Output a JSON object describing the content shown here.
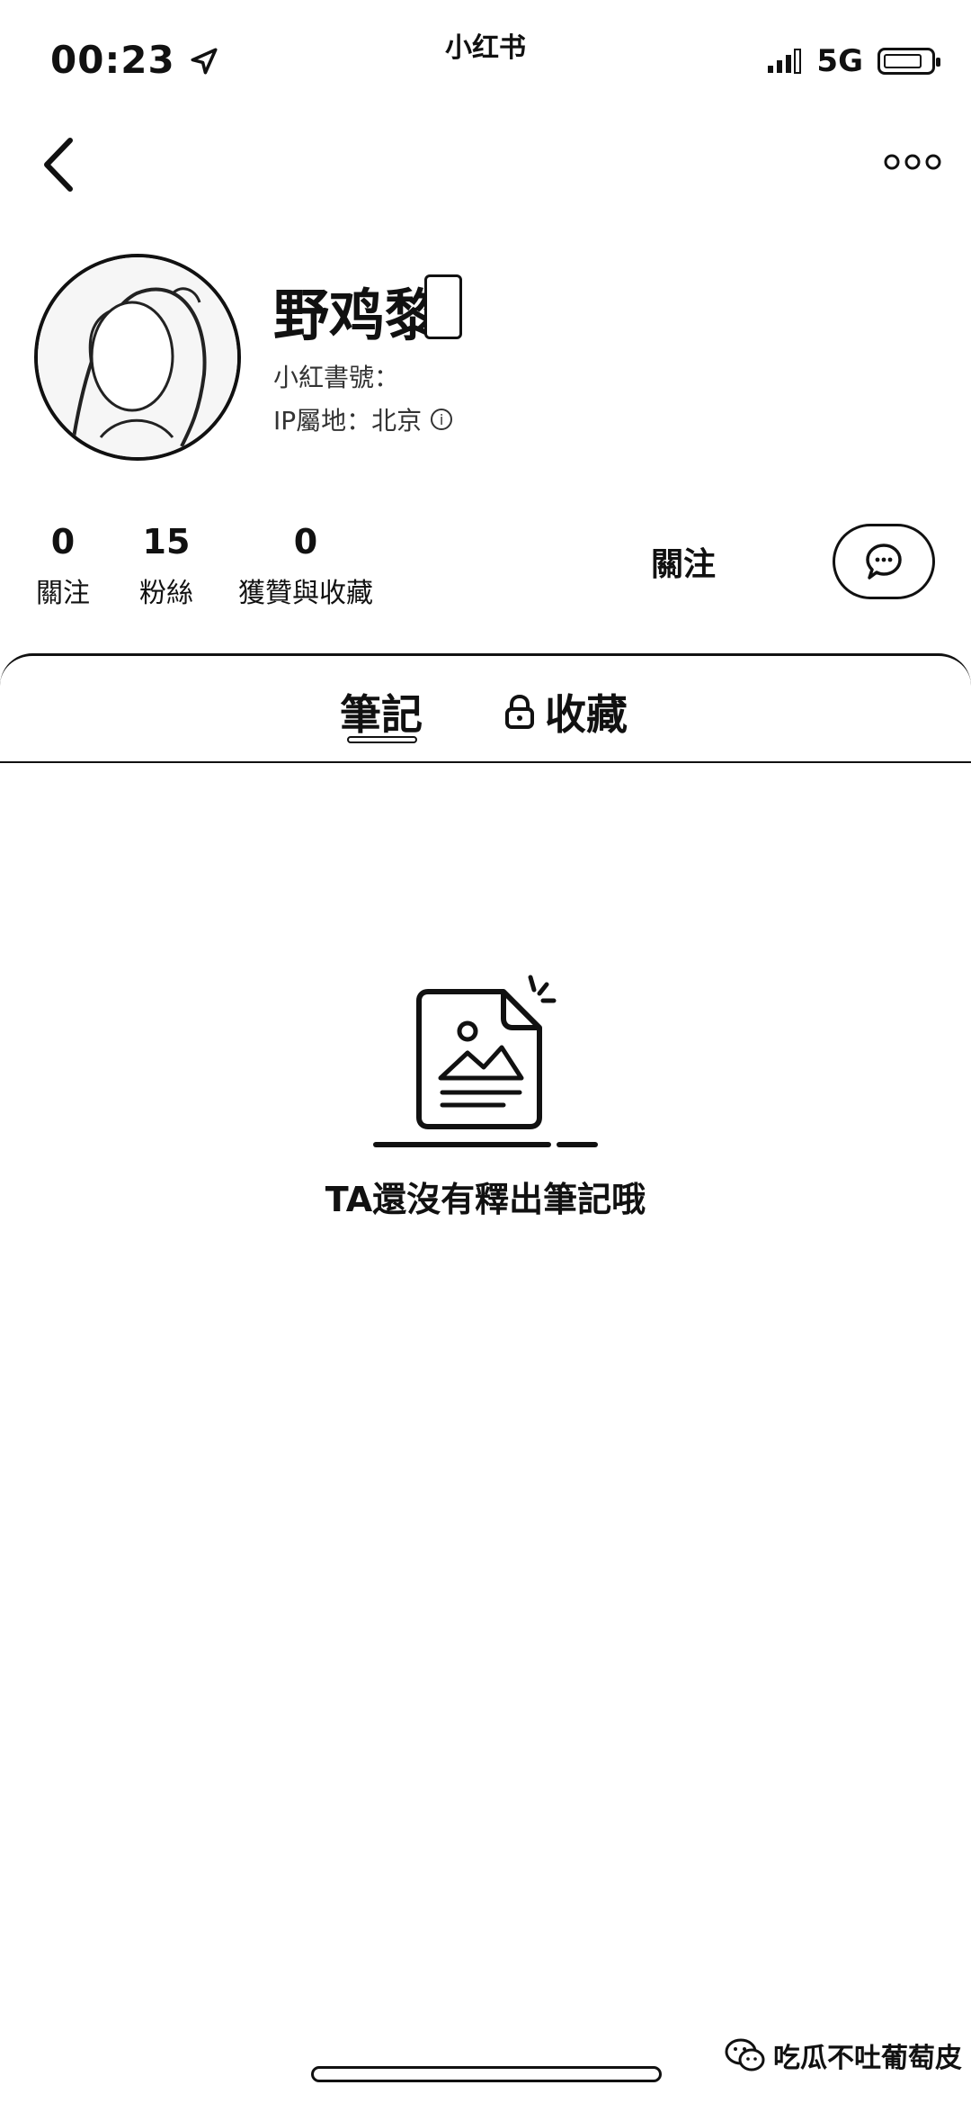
{
  "status_bar": {
    "time": "00:23",
    "app_name": "小红书",
    "network": "5G"
  },
  "profile": {
    "nickname": "野鸡黎",
    "red_id_label": "小紅書號：",
    "ip_label": "IP屬地：北京"
  },
  "stats": [
    {
      "value": "0",
      "label": "關注"
    },
    {
      "value": "15",
      "label": "粉絲"
    },
    {
      "value": "0",
      "label": "獲贊與收藏"
    }
  ],
  "actions": {
    "follow_label": "關注"
  },
  "tabs": [
    {
      "label": "筆記",
      "active": true
    },
    {
      "label": "收藏",
      "active": false,
      "icon": "lock-icon"
    }
  ],
  "empty_state": {
    "message": "TA還沒有釋出筆記哦"
  },
  "watermark": {
    "text": "吃瓜不吐葡萄皮",
    "icon": "wechat-icon"
  }
}
